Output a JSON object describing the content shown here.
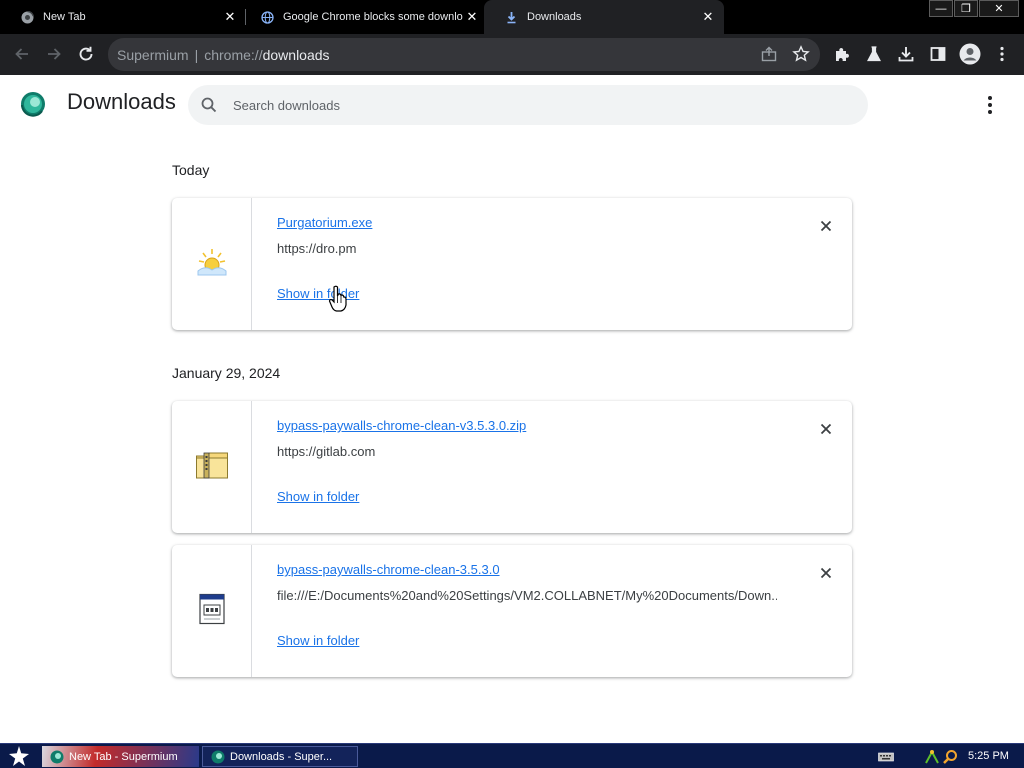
{
  "browser": {
    "tabs": [
      {
        "title": "New Tab",
        "active": false
      },
      {
        "title": "Google Chrome blocks some downlo",
        "active": false
      },
      {
        "title": "Downloads",
        "active": true
      }
    ],
    "window_controls": {
      "minimize": "—",
      "restore": "❐",
      "close": "✕"
    },
    "omnibox": {
      "host": "Supermium",
      "separator": "|",
      "scheme": "chrome://",
      "path": "downloads"
    }
  },
  "page": {
    "title": "Downloads",
    "search_placeholder": "Search downloads"
  },
  "downloads": {
    "groups": [
      {
        "date": "Today",
        "items": [
          {
            "filename": "Purgatorium.exe",
            "url": "https://dro.pm",
            "action": "Show in folder",
            "icon": "application-exe-icon"
          }
        ]
      },
      {
        "date": "January 29, 2024",
        "items": [
          {
            "filename": "bypass-paywalls-chrome-clean-v3.5.3.0.zip",
            "url": "https://gitlab.com",
            "action": "Show in folder",
            "icon": "zip-folder-icon"
          },
          {
            "filename": "bypass-paywalls-chrome-clean-3.5.3.0",
            "url": "file:///E:/Documents%20and%20Settings/VM2.COLLABNET/My%20Documents/Down...",
            "action": "Show in folder",
            "icon": "generic-file-icon"
          }
        ]
      }
    ]
  },
  "taskbar": {
    "items": [
      {
        "label": "New Tab - Supermium"
      },
      {
        "label": "Downloads - Super..."
      }
    ],
    "clock": "5:25 PM"
  },
  "colors": {
    "link": "#1a73e8",
    "tabstrip": "#000000",
    "toolbar": "#202124",
    "taskbar": "#0a1a4a"
  }
}
